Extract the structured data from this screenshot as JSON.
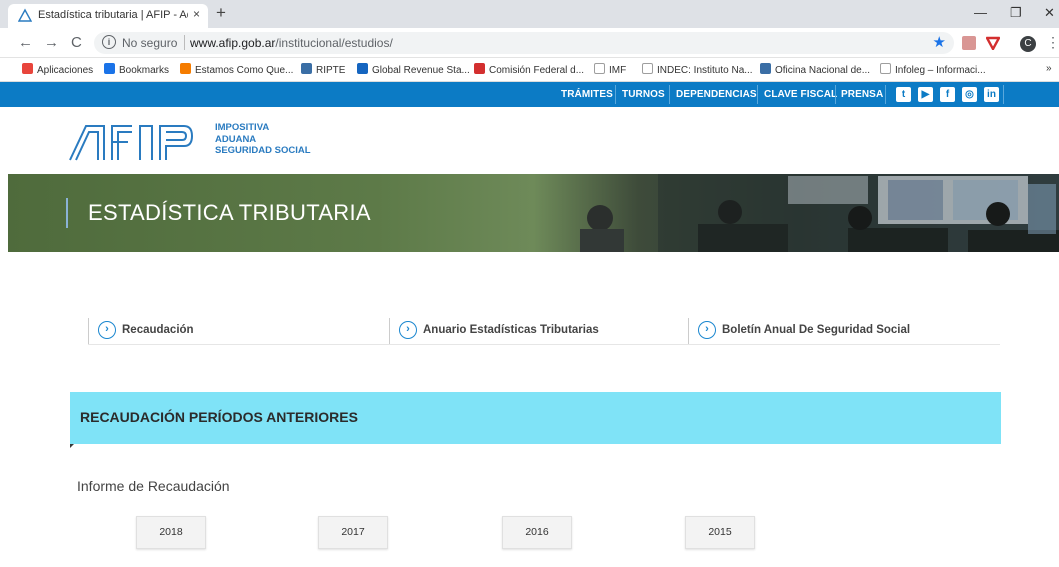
{
  "browser": {
    "tab_title": "Estadística tributaria | AFIP - Adm",
    "tab_close": "×",
    "new_tab": "+",
    "window_controls": {
      "minimize": "—",
      "restore": "❐",
      "close": "✕"
    },
    "nav": {
      "back": "←",
      "forward": "→",
      "reload": "C"
    },
    "insecure_label": "No seguro",
    "url_host": "www.afip.gob.ar",
    "url_path": "/institucional/estudios/",
    "profile_initial": "C",
    "bookmarks": [
      {
        "label": "Aplicaciones",
        "icon": "apps-grid-icon",
        "color": "#e8453c"
      },
      {
        "label": "Bookmarks",
        "icon": "star-icon",
        "color": "#1a73e8"
      },
      {
        "label": "Estamos Como Que...",
        "icon": "folder-icon",
        "color": "#f57c00"
      },
      {
        "label": "RIPTE",
        "icon": "gov-icon",
        "color": "#3a6ea5"
      },
      {
        "label": "Global Revenue Sta...",
        "icon": "oecd-icon",
        "color": "#1565c0"
      },
      {
        "label": "Comisión Federal d...",
        "icon": "cfi-icon",
        "color": "#d32f2f"
      },
      {
        "label": "IMF",
        "icon": "page-icon",
        "color": "#9e9e9e"
      },
      {
        "label": "INDEC: Instituto Na...",
        "icon": "page-icon",
        "color": "#9e9e9e"
      },
      {
        "label": "Oficina Nacional de...",
        "icon": "gov-icon",
        "color": "#3a6ea5"
      },
      {
        "label": "Infoleg – Informaci...",
        "icon": "page-icon",
        "color": "#9e9e9e"
      }
    ],
    "more_bookmarks": "»"
  },
  "topnav": {
    "links": [
      "TRÁMITES",
      "TURNOS",
      "DEPENDENCIAS",
      "CLAVE FISCAL",
      "PRENSA"
    ],
    "social": [
      {
        "name": "twitter-icon",
        "glyph": "t"
      },
      {
        "name": "youtube-icon",
        "glyph": "▶"
      },
      {
        "name": "facebook-icon",
        "glyph": "f"
      },
      {
        "name": "instagram-icon",
        "glyph": "◎"
      },
      {
        "name": "linkedin-icon",
        "glyph": "in"
      }
    ]
  },
  "header": {
    "logo_text": "AFIP",
    "tagline": [
      "IMPOSITIVA",
      "ADUANA",
      "SEGURIDAD SOCIAL"
    ]
  },
  "hero": {
    "title": "ESTADÍSTICA TRIBUTARIA"
  },
  "links": [
    {
      "label": "Recaudación"
    },
    {
      "label": "Anuario Estadísticas Tributarias"
    },
    {
      "label": "Boletín Anual De Seguridad Social"
    }
  ],
  "section": {
    "title": "RECAUDACIÓN PERÍODOS ANTERIORES"
  },
  "informe": {
    "label": "Informe de Recaudación",
    "years": [
      "2018",
      "2017",
      "2016",
      "2015"
    ]
  },
  "colors": {
    "nav_blue": "#0c7bc5",
    "band_cyan": "#7fe3f7",
    "link_blue": "#1b87cf",
    "logo_blue": "#2a7bc0"
  }
}
